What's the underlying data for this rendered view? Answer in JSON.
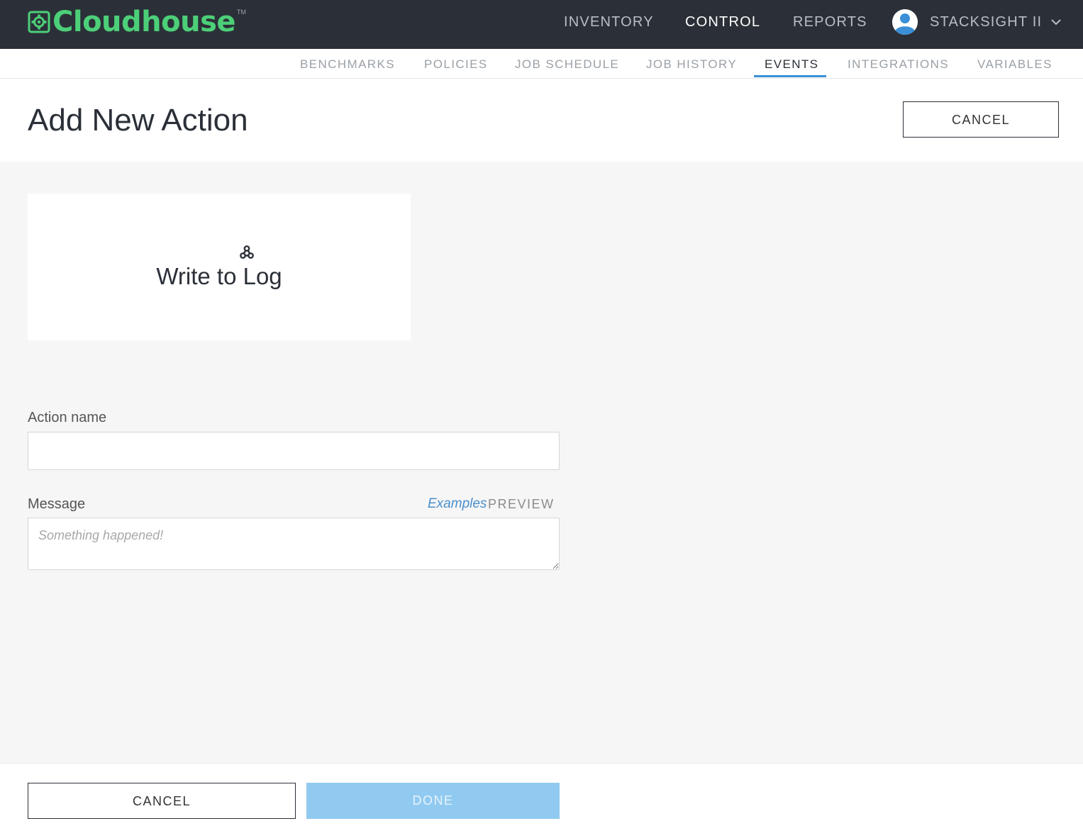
{
  "app": {
    "brand": "Cloudhouse",
    "trademark": "TM",
    "brand_color": "#4ccf78",
    "accent_color": "#3a8fd6"
  },
  "main_nav": {
    "items": [
      {
        "label": "INVENTORY",
        "active": false
      },
      {
        "label": "CONTROL",
        "active": true
      },
      {
        "label": "REPORTS",
        "active": false
      }
    ]
  },
  "user": {
    "name": "STACKSIGHT II",
    "avatar_icon": "user-avatar-icon",
    "menu_icon": "chevron-down-icon"
  },
  "sub_nav": {
    "items": [
      {
        "label": "BENCHMARKS",
        "active": false
      },
      {
        "label": "POLICIES",
        "active": false
      },
      {
        "label": "JOB SCHEDULE",
        "active": false
      },
      {
        "label": "JOB HISTORY",
        "active": false
      },
      {
        "label": "EVENTS",
        "active": true
      },
      {
        "label": "INTEGRATIONS",
        "active": false
      },
      {
        "label": "VARIABLES",
        "active": false
      }
    ]
  },
  "page": {
    "title": "Add New Action",
    "cancel_label": "CANCEL"
  },
  "action_card": {
    "icon": "webhook-icon",
    "label": "Write to Log"
  },
  "form": {
    "action_name": {
      "label": "Action name",
      "value": "",
      "placeholder": ""
    },
    "message": {
      "label": "Message",
      "value": "",
      "placeholder": "Something happened!",
      "examples_label": "Examples",
      "preview_label": "PREVIEW"
    }
  },
  "footer": {
    "cancel_label": "CANCEL",
    "done_label": "DONE",
    "done_enabled": false
  }
}
